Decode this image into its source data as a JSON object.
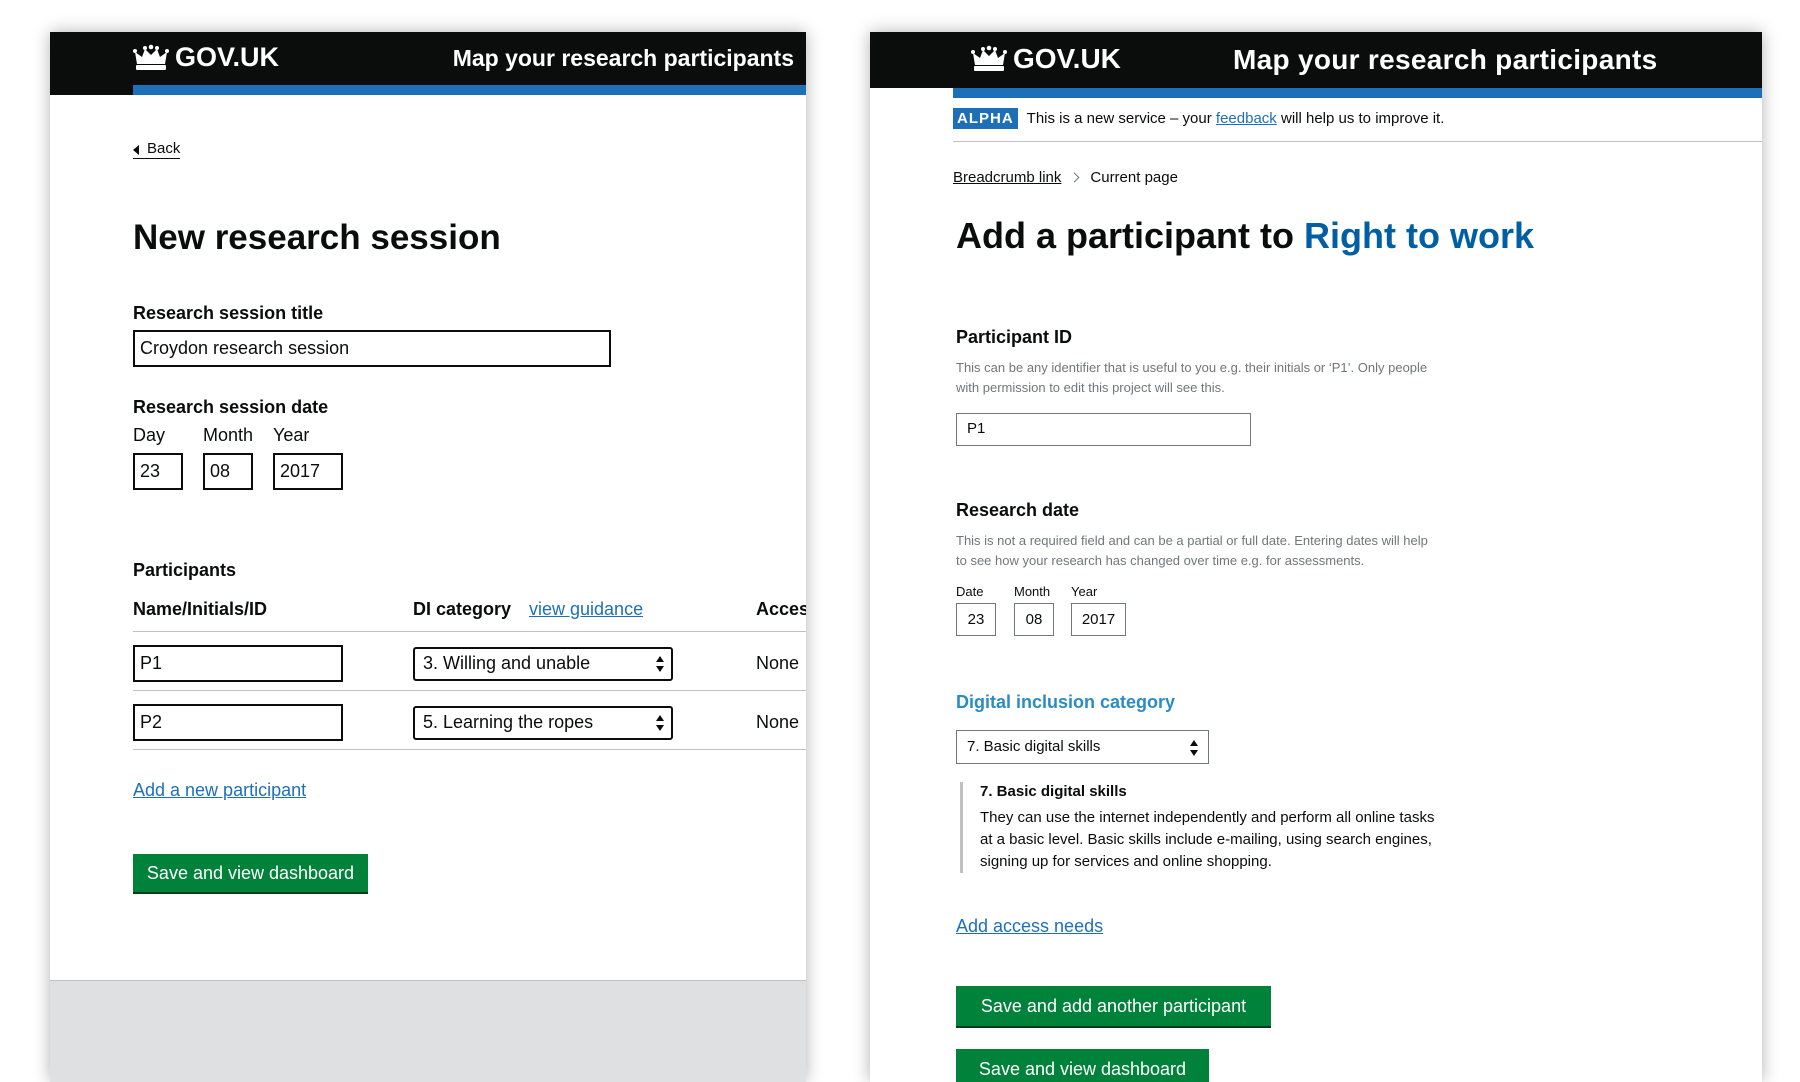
{
  "left": {
    "header": {
      "logo": "GOV.UK",
      "service": "Map your research participants"
    },
    "back": "Back",
    "title": "New research session",
    "session_title": {
      "label": "Research session title",
      "value": "Croydon research session"
    },
    "session_date": {
      "label": "Research session date",
      "day_label": "Day",
      "month_label": "Month",
      "year_label": "Year",
      "day": "23",
      "month": "08",
      "year": "2017"
    },
    "participants": {
      "label": "Participants",
      "col_name": "Name/Initials/ID",
      "col_di": "DI category",
      "guidance_link": "view guidance",
      "col_access": "Acces",
      "rows": [
        {
          "id": "P1",
          "category": "3. Willing and unable",
          "access": "None"
        },
        {
          "id": "P2",
          "category": "5. Learning the ropes",
          "access": "None"
        }
      ]
    },
    "add_link": "Add a new participant",
    "save_button": "Save and view dashboard"
  },
  "right": {
    "header": {
      "logo": "GOV.UK",
      "service": "Map your research participants"
    },
    "phase": {
      "tag": "ALPHA",
      "text_before": "This is a new service – your ",
      "link": "feedback",
      "text_after": " will help us to improve it."
    },
    "breadcrumbs": {
      "link": "Breadcrumb link",
      "current": "Current page"
    },
    "title": {
      "prefix": "Add a participant to ",
      "project": "Right to work"
    },
    "participant_id": {
      "label": "Participant ID",
      "hint": "This can be any identifier that is useful to you e.g. their initials or ‘P1’. Only people with permission to edit this project will see this.",
      "value": "P1"
    },
    "research_date": {
      "label": "Research date",
      "hint": "This is not a required field and can be a partial or full date. Entering dates will help to see how your research has changed over time e.g. for assessments.",
      "day_label": "Date",
      "month_label": "Month",
      "year_label": "Year",
      "day": "23",
      "month": "08",
      "year": "2017"
    },
    "di_category": {
      "label": "Digital inclusion category",
      "selected": "7. Basic digital skills",
      "detail_title": "7. Basic digital skills",
      "detail_text": "They can use the internet independently and perform all online tasks at a basic level. Basic skills include e-mailing, using search engines, signing up for services and online shopping."
    },
    "access_link": "Add access needs",
    "save_add_button": "Save and add another participant",
    "save_view_button": "Save and view dashboard"
  },
  "colors": {
    "header_bg": "#0b0c0c",
    "blue_bar": "#1d70b8",
    "link": "#1d70b8",
    "button_green": "#00823b",
    "accent_title": "#005ea5",
    "di_label": "#2b8cc4"
  }
}
